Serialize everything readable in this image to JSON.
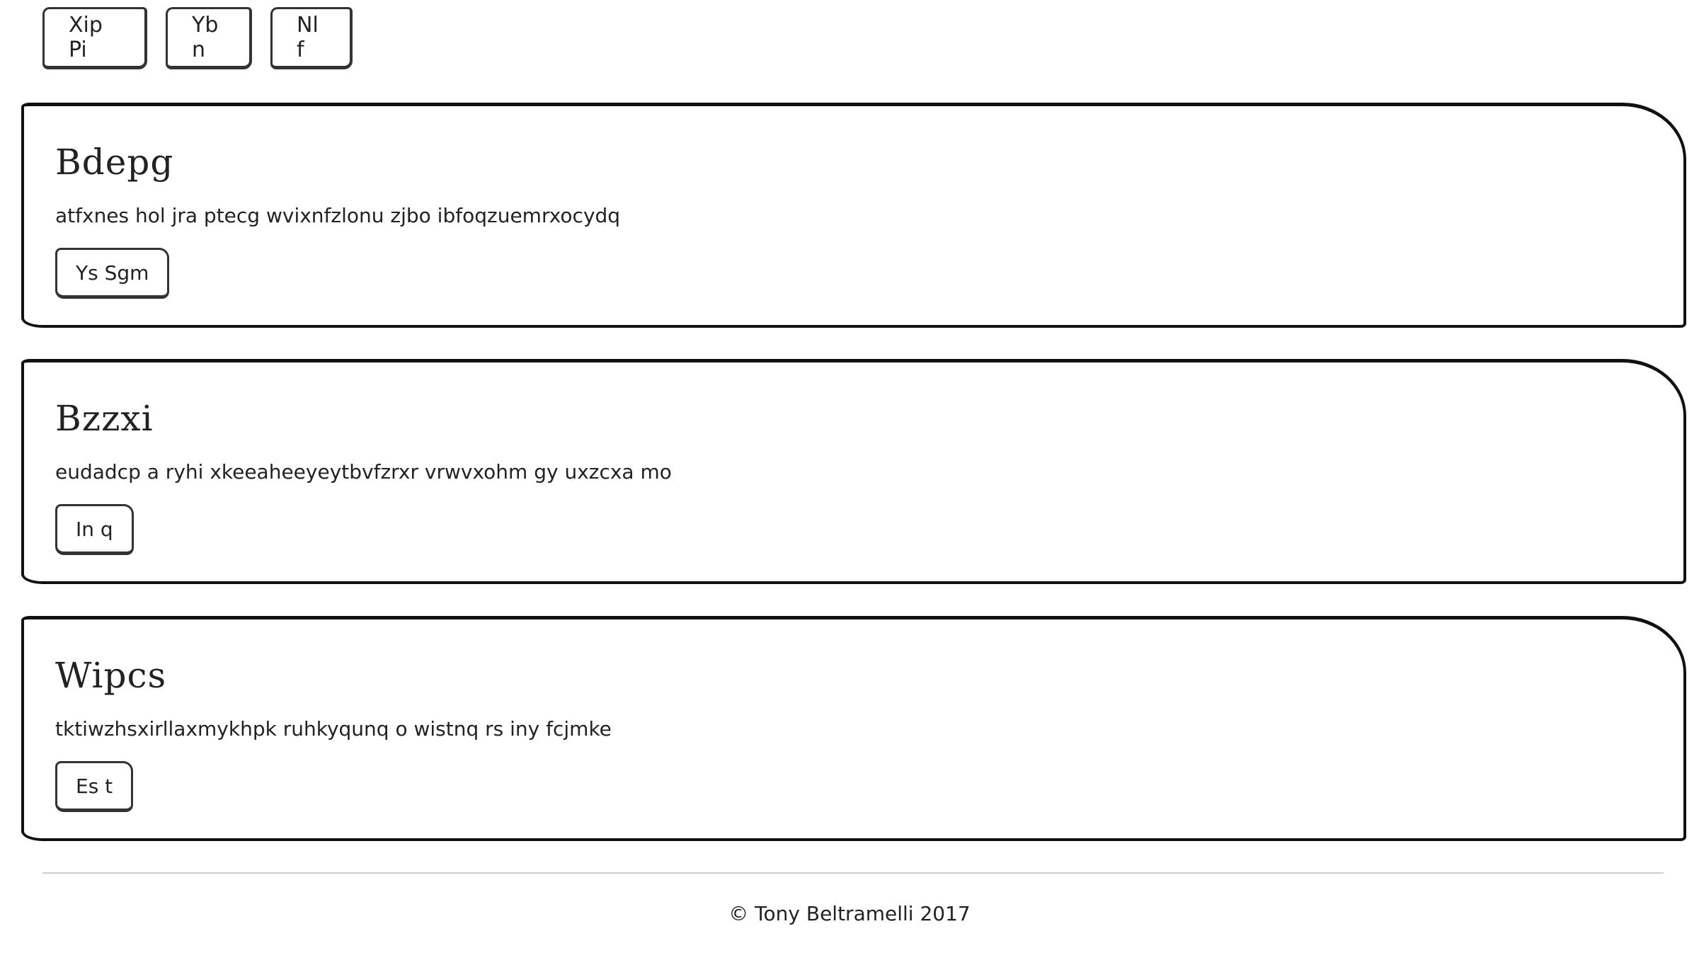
{
  "nav": {
    "buttons": [
      {
        "label": "Xip Pi"
      },
      {
        "label": "Yb n"
      },
      {
        "label": "Nl f"
      }
    ]
  },
  "cards": [
    {
      "title": "Bdepg",
      "text": "atfxnes hol jra ptecg wvixnfzlonu zjbo ibfoqzuemrxocydq",
      "button": "Ys Sgm"
    },
    {
      "title": "Bzzxi",
      "text": "eudadcp a ryhi xkeeaheeyeytbvfzrxr vrwvxohm gy uxzcxa mo",
      "button": "In q"
    },
    {
      "title": "Wipcs",
      "text": "tktiwzhsxirllaxmykhpk ruhkyqunq o wistnq rs iny fcjmke",
      "button": "Es t"
    }
  ],
  "footer": {
    "copyright": "© Tony Beltramelli 2017"
  }
}
